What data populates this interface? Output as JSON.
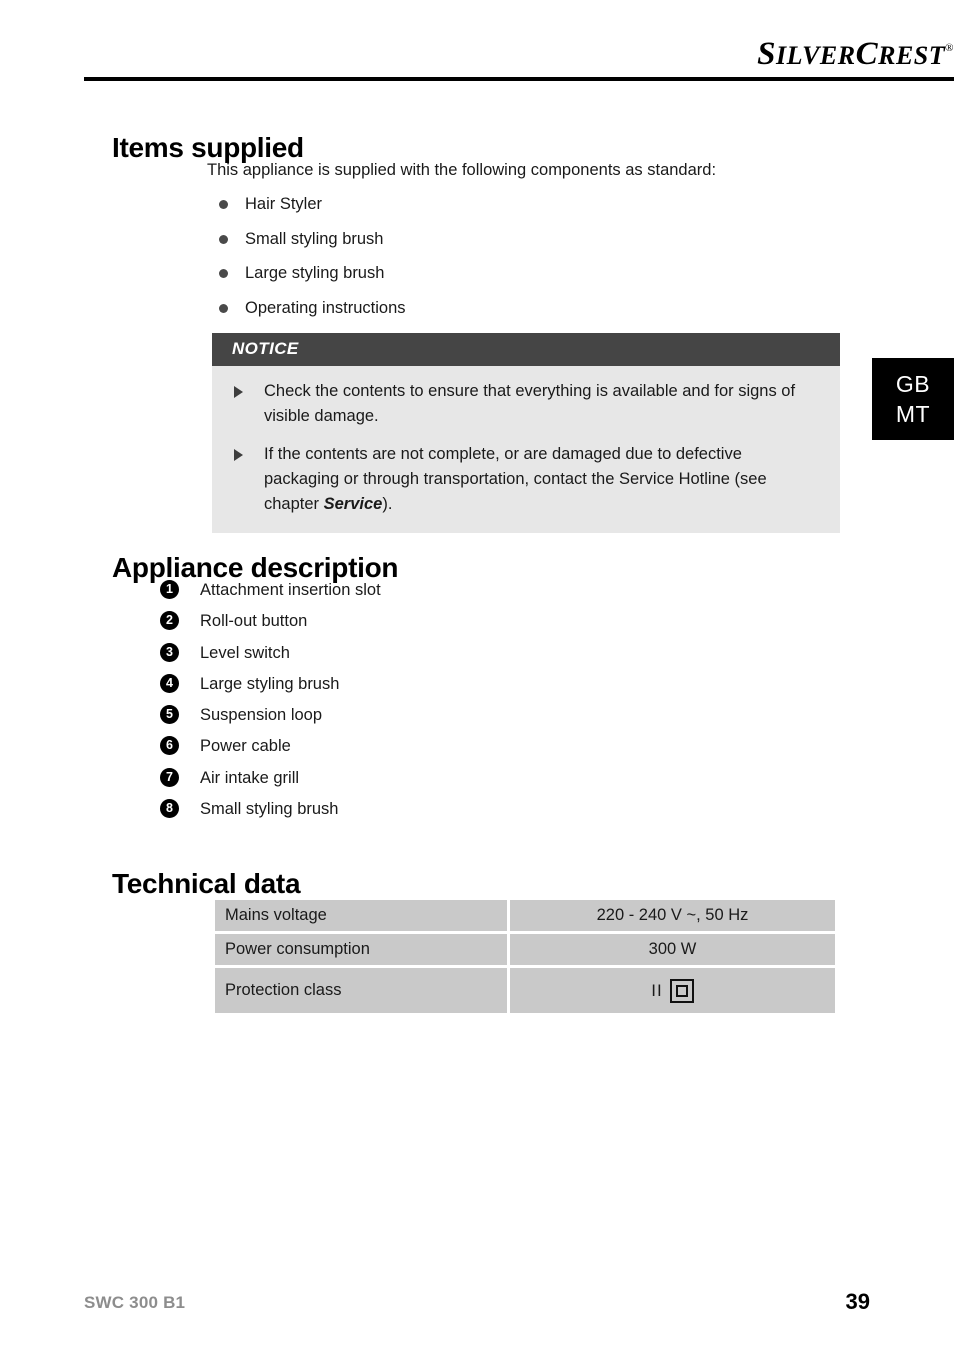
{
  "header": {
    "brand_first": "S",
    "brand_first_rest": "ILVER",
    "brand_second": "C",
    "brand_second_rest": "REST",
    "registered_mark": "®"
  },
  "language_tab": {
    "line1": "GB",
    "line2": "MT"
  },
  "sections": {
    "items_supplied": {
      "heading": "Items supplied",
      "intro": "This appliance is supplied with the following components as standard:",
      "bullets": [
        "Hair Styler",
        "Small styling brush",
        "Large styling brush",
        "Operating instructions"
      ]
    },
    "notice": {
      "title": "NOTICE",
      "items": [
        {
          "text_before": "Check the contents to ensure that everything is available and for signs of visible damage.",
          "bold": "",
          "text_after": ""
        },
        {
          "text_before": "If the contents are not complete, or are damaged due to defective packaging or through transportation, contact the Service Hotline (see chapter ",
          "bold": "Service",
          "text_after": ")."
        }
      ]
    },
    "appliance_description": {
      "heading": "Appliance description",
      "parts": [
        {
          "number": "1",
          "label": "Attachment insertion slot"
        },
        {
          "number": "2",
          "label": "Roll-out button"
        },
        {
          "number": "3",
          "label": "Level switch"
        },
        {
          "number": "4",
          "label": "Large styling brush"
        },
        {
          "number": "5",
          "label": "Suspension loop"
        },
        {
          "number": "6",
          "label": "Power cable"
        },
        {
          "number": "7",
          "label": "Air intake grill"
        },
        {
          "number": "8",
          "label": "Small styling brush"
        }
      ]
    },
    "technical_data": {
      "heading": "Technical data",
      "rows": [
        {
          "label": "Mains voltage",
          "value": "220 - 240 V ~, 50 Hz"
        },
        {
          "label": "Power consumption",
          "value": "300 W"
        },
        {
          "label": "Protection class",
          "value": "II",
          "symbol": "double-insulation-square"
        }
      ]
    }
  },
  "footer": {
    "model": "SWC 300 B1",
    "page_number": "39"
  },
  "colors": {
    "notice_header_bg": "#454545",
    "notice_body_bg": "#e7e7e7",
    "table_cell_bg": "#c9c9c9",
    "lang_tab_bg": "#000000",
    "footer_model_text": "#8d8d8d"
  }
}
